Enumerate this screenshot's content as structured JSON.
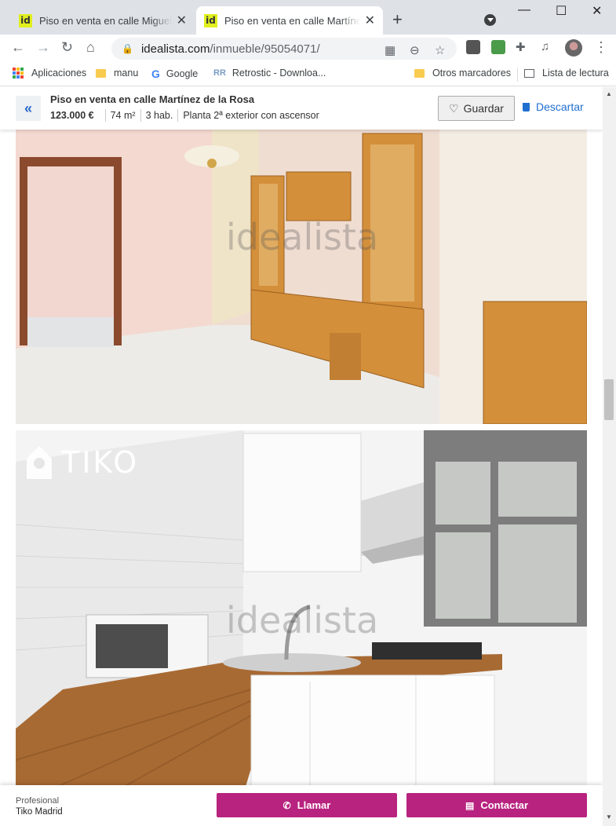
{
  "browser": {
    "tabs": [
      {
        "title": "Piso en venta en calle Miguel Moya",
        "favicon": "id"
      },
      {
        "title": "Piso en venta en calle Martínez de la Rosa",
        "favicon": "id"
      }
    ],
    "url_host": "idealista.com",
    "url_path": "/inmueble/95054071/",
    "bookmarks": [
      "Aplicaciones",
      "manu",
      "Google",
      "Retrostic - Downloa...",
      "Otros marcadores",
      "Lista de lectura"
    ]
  },
  "listing": {
    "title": "Piso en venta en calle Martínez de la Rosa",
    "price": "123.000 €",
    "area": "74 m²",
    "rooms": "3 hab.",
    "floor": "Planta 2ª exterior con ascensor",
    "save_label": "Guardar",
    "discard_label": "Descartar"
  },
  "photos": {
    "watermark": "idealista",
    "agency_logo": "TIKO"
  },
  "advertiser": {
    "type": "Profesional",
    "name": "Tiko Madrid"
  },
  "actions": {
    "call_label": "Llamar",
    "contact_label": "Contactar"
  },
  "colors": {
    "accent": "#b8237f",
    "link": "#1f6fd1",
    "favicon": "#e1f01f"
  }
}
